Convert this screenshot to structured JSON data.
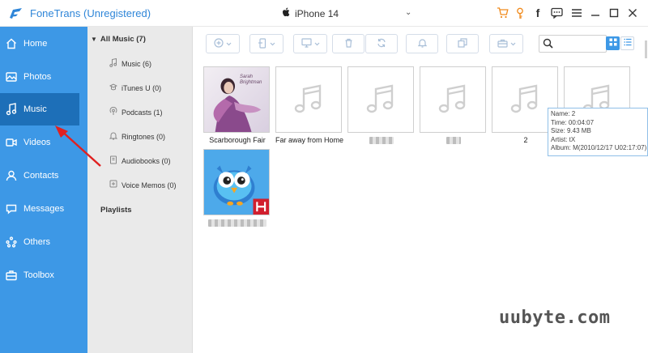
{
  "app": {
    "title": "FoneTrans (Unregistered)",
    "device": "iPhone 14",
    "accent": "#3d98e6",
    "accent_dark": "#1d6fb8"
  },
  "titlebar_icons": [
    "cart-icon",
    "key-icon",
    "facebook-icon",
    "feedback-icon",
    "menu-icon",
    "minimize-icon",
    "maximize-icon",
    "close-icon"
  ],
  "nav": {
    "items": [
      {
        "label": "Home",
        "icon": "home-icon"
      },
      {
        "label": "Photos",
        "icon": "photos-icon"
      },
      {
        "label": "Music",
        "icon": "music-icon",
        "active": true
      },
      {
        "label": "Videos",
        "icon": "videos-icon"
      },
      {
        "label": "Contacts",
        "icon": "contacts-icon"
      },
      {
        "label": "Messages",
        "icon": "messages-icon"
      },
      {
        "label": "Others",
        "icon": "others-icon"
      },
      {
        "label": "Toolbox",
        "icon": "toolbox-icon"
      }
    ]
  },
  "categories": {
    "header": "All Music (7)",
    "items": [
      {
        "label": "Music (6)",
        "icon": "music-note-icon"
      },
      {
        "label": "iTunes U (0)",
        "icon": "itunes-u-icon"
      },
      {
        "label": "Podcasts (1)",
        "icon": "podcast-icon"
      },
      {
        "label": "Ringtones (0)",
        "icon": "bell-icon"
      },
      {
        "label": "Audiobooks (0)",
        "icon": "audiobook-icon"
      },
      {
        "label": "Voice Memos (0)",
        "icon": "voice-memo-icon"
      }
    ],
    "playlists": "Playlists"
  },
  "toolbar": {
    "buttons": [
      "add-button",
      "export-to-device-button",
      "export-to-pc-button",
      "delete-button",
      "sync-button",
      "ringtone-button",
      "copy-button",
      "toolbox-button"
    ],
    "search_value": "",
    "view": "grid"
  },
  "tracks": [
    {
      "title": "Scarborough Fair",
      "art": "cover",
      "album_text": "Sarah Brightman"
    },
    {
      "title": "Far away from Home",
      "art": "placeholder"
    },
    {
      "title": "",
      "art": "placeholder",
      "blurred": true
    },
    {
      "title": "",
      "art": "placeholder",
      "blurred": true
    },
    {
      "title": "2",
      "art": "placeholder"
    },
    {
      "title": "",
      "art": "placeholder"
    },
    {
      "title": "",
      "art": "owl",
      "blurred": true
    }
  ],
  "tooltip": {
    "name": "Name: 2",
    "time": "Time: 00:04:07",
    "size": "Size: 9.43 MB",
    "artist": "Artist: tX",
    "album": "Album: M(2010/12/17 U02:17:07)"
  },
  "watermark": "uubyte.com"
}
